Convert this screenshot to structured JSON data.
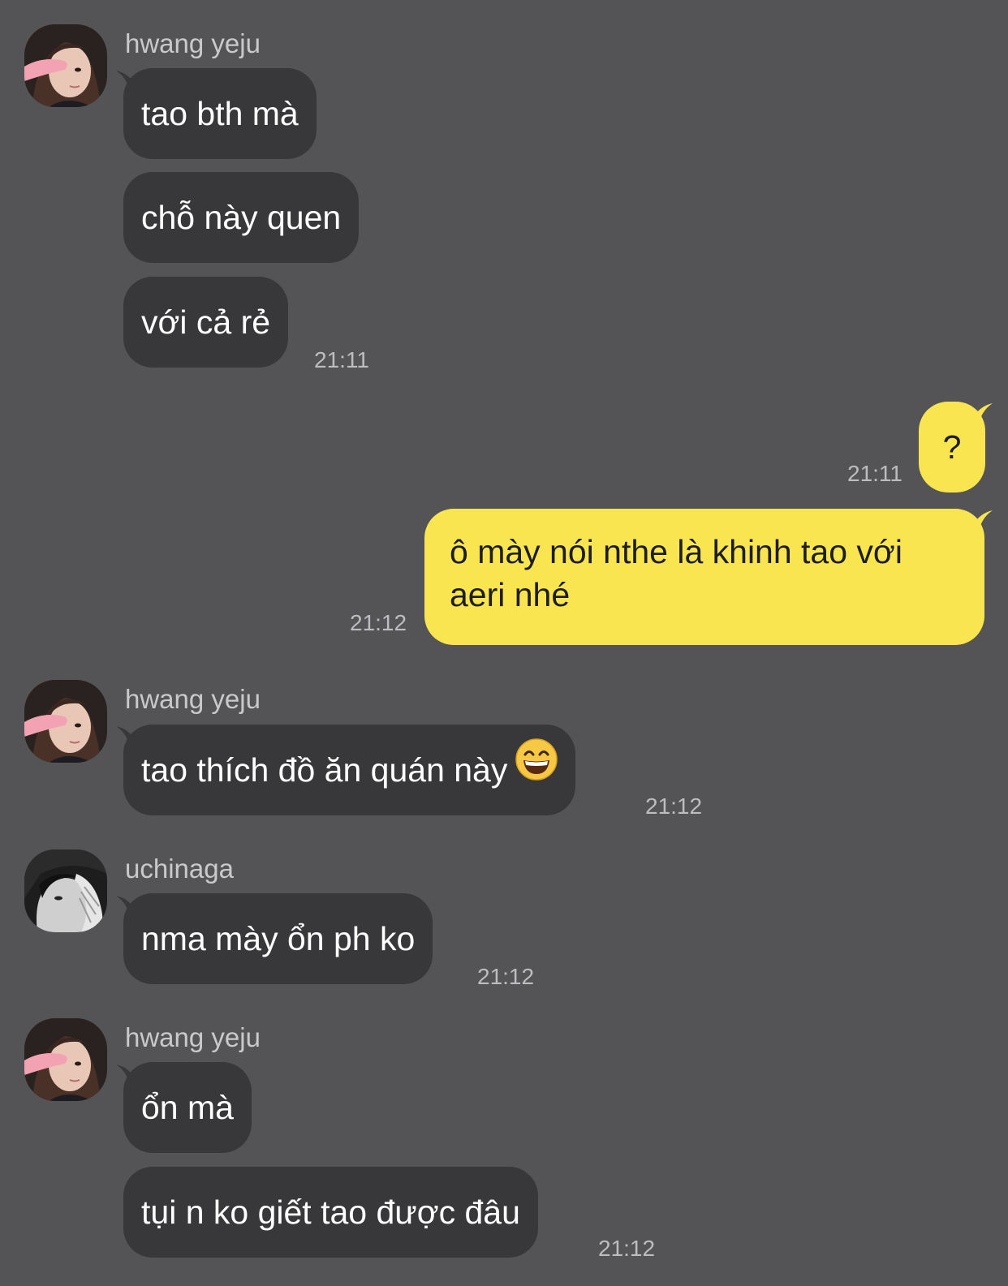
{
  "colors": {
    "background": "#545355",
    "incoming_bubble": "#383739",
    "outgoing_bubble": "#f9e54f",
    "timestamp": "#bdbcc0",
    "sender_name": "#c9c8cb"
  },
  "messages": {
    "g1": {
      "sender": "hwang yeju",
      "bubbles": [
        "tao bth mà",
        "chỗ này quen",
        "với cả rẻ"
      ],
      "time": "21:11"
    },
    "out1": {
      "text": "?",
      "time": "21:11"
    },
    "out2": {
      "line1": "ô mày nói nthe là khinh tao với",
      "line2": "aeri nhé",
      "time": "21:12"
    },
    "g2": {
      "sender": "hwang yeju",
      "text": "tao thích đồ ăn quán này",
      "emoji": "grinning-face-emoji",
      "time": "21:12"
    },
    "g3": {
      "sender": "uchinaga",
      "text": "nma mày ổn ph ko",
      "time": "21:12"
    },
    "g4": {
      "sender": "hwang yeju",
      "bubbles": [
        "ổn mà",
        "tụi n ko giết tao được đâu"
      ],
      "time": "21:12"
    }
  }
}
